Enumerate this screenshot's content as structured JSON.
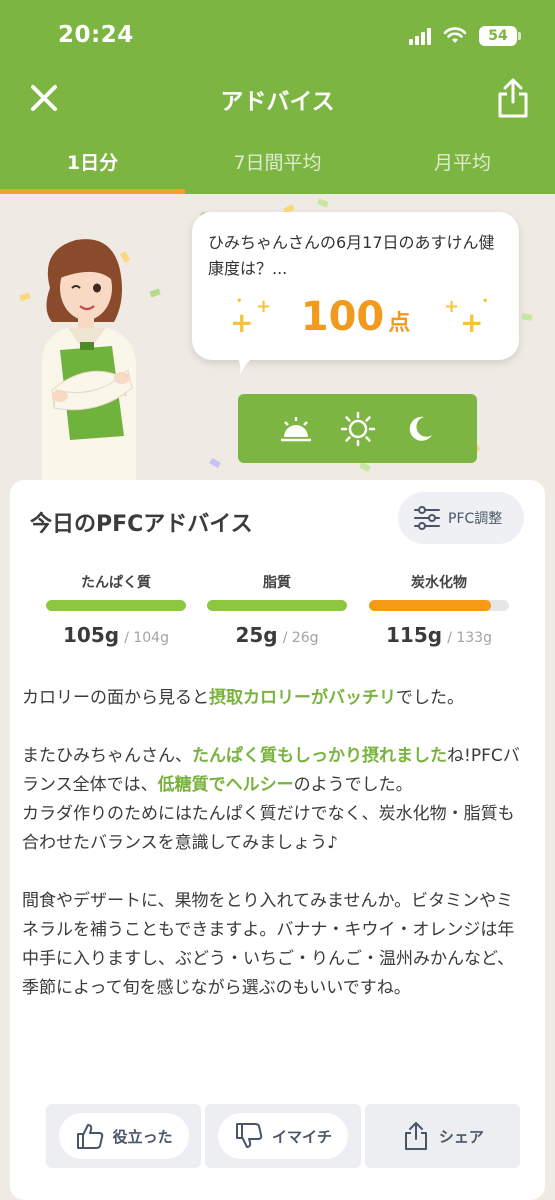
{
  "status": {
    "time": "20:24",
    "battery": "54"
  },
  "nav": {
    "title": "アドバイス"
  },
  "tabs": [
    {
      "label": "1日分",
      "active": true
    },
    {
      "label": "7日間平均",
      "active": false
    },
    {
      "label": "月平均",
      "active": false
    }
  ],
  "score_bubble": {
    "text": "ひみちゃんさんの6月17日のあすけん健康度は？...",
    "score": "100",
    "unit": "点"
  },
  "time_switch": [
    "sunrise-icon",
    "sun-icon",
    "moon-icon"
  ],
  "pfc": {
    "title": "今日のPFCアドバイス",
    "adjust_label": "PFC調整",
    "nutrients": [
      {
        "name": "たんぱく質",
        "value": "105g",
        "target": "/ 104g",
        "fill": 1.0,
        "color": "#8dc63f"
      },
      {
        "name": "脂質",
        "value": "25g",
        "target": "/ 26g",
        "fill": 1.0,
        "color": "#8dc63f"
      },
      {
        "name": "炭水化物",
        "value": "115g",
        "target": "/ 133g",
        "fill": 0.87,
        "color": "#f59a12"
      }
    ]
  },
  "advice": {
    "p1_a": "カロリーの面から見ると",
    "p1_hl": "摂取カロリーがバッチリ",
    "p1_b": "でした。",
    "p2_a": "またひみちゃんさん、",
    "p2_hl": "たんぱく質もしっかり摂れました",
    "p2_b": "ね!PFCバランス全体では、",
    "p2_hl2": "低糖質でヘルシー",
    "p2_c": "のようでした。",
    "p3": "カラダ作りのためにはたんぱく質だけでなく、炭水化物・脂質も合わせたバランスを意識してみましょう♪",
    "p4": "間食やデザートに、果物をとり入れてみませんか。ビタミンやミネラルを補うこともできますよ。バナナ・キウイ・オレンジは年中手に入りますし、ぶどう・いちご・りんご・温州みかんなど、季節によって旬を感じながら選ぶのもいいですね。"
  },
  "feedback": {
    "useful": "役立った",
    "meh": "イマイチ",
    "share": "シェア"
  },
  "colors": {
    "brand_green": "#7db542",
    "accent_orange": "#f5a028",
    "highlight_green": "#79b33d"
  }
}
